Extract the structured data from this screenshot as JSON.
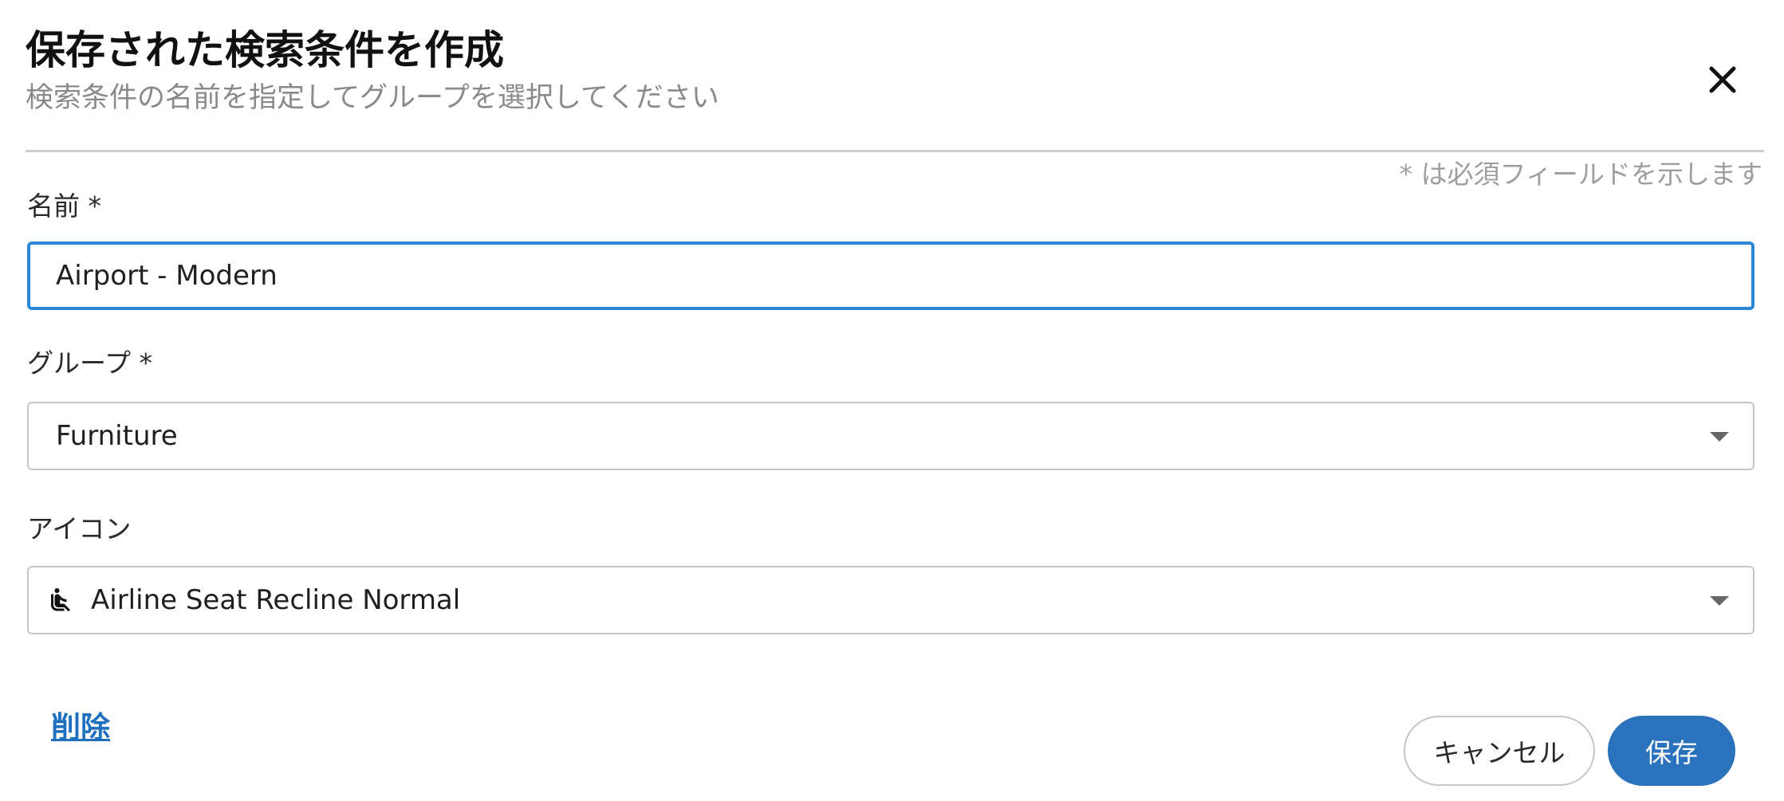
{
  "dialog": {
    "title": "保存された検索条件を作成",
    "subtitle": "検索条件の名前を指定してグループを選択してください",
    "required_note": "* は必須フィールドを示します",
    "close_icon": "close-icon"
  },
  "form": {
    "name": {
      "label": "名前 *",
      "value": "Airport - Modern"
    },
    "group": {
      "label": "グループ *",
      "selected": "Furniture"
    },
    "icon": {
      "label": "アイコン",
      "selected": "Airline Seat Recline Normal",
      "selected_icon": "airline-seat-recline-normal-icon"
    }
  },
  "actions": {
    "delete_label": "削除",
    "cancel_label": "キャンセル",
    "save_label": "保存"
  },
  "colors": {
    "accent": "#2a72bb",
    "focus_border": "#2b87d8",
    "link": "#1f6fbf"
  }
}
